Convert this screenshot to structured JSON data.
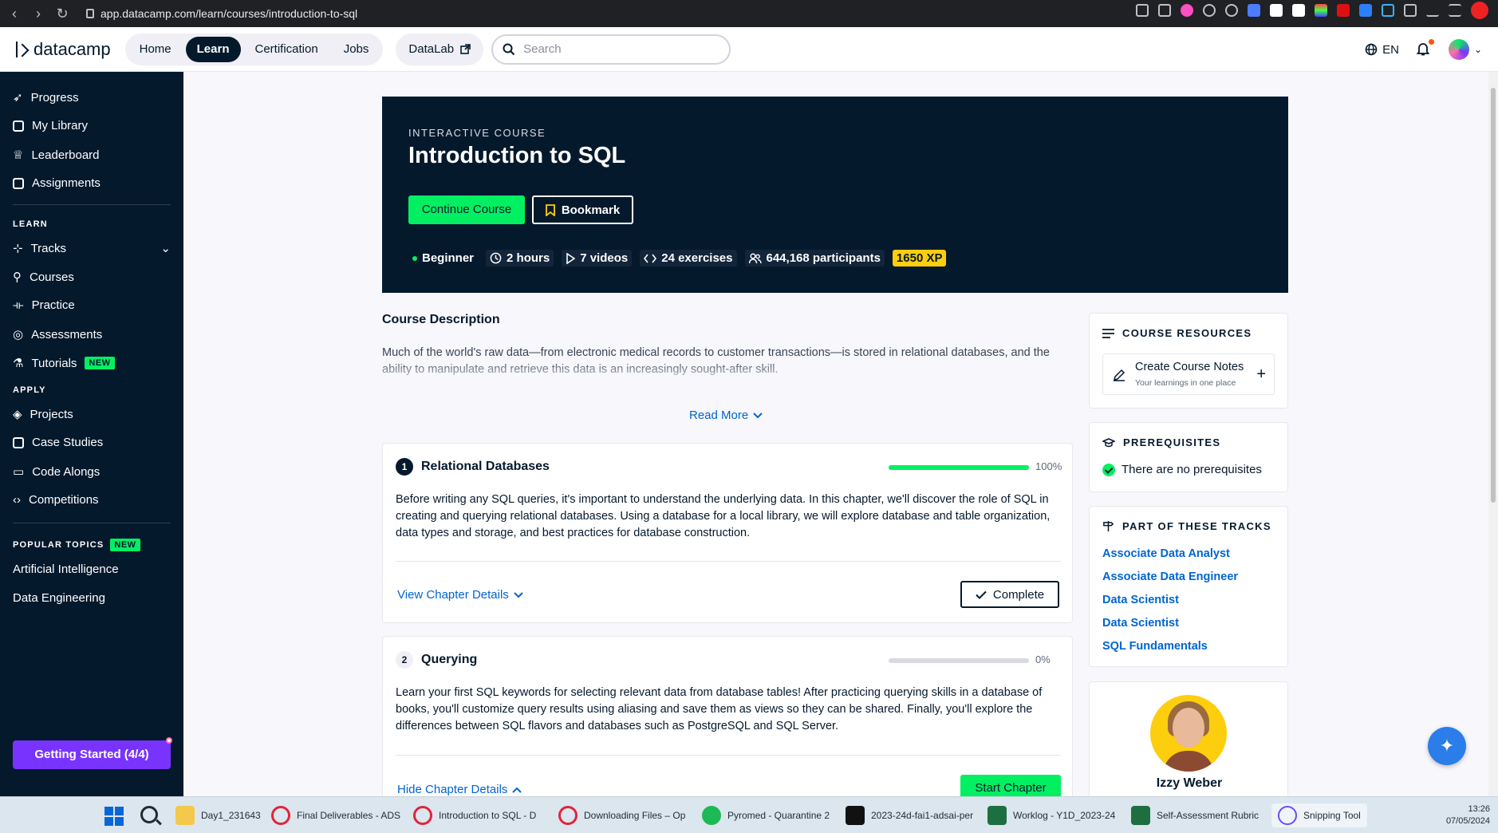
{
  "browser": {
    "url": "app.datacamp.com/learn/courses/introduction-to-sql"
  },
  "topnav": {
    "logo": "datacamp",
    "items": [
      "Home",
      "Learn",
      "Certification",
      "Jobs"
    ],
    "active": "Learn",
    "datalab": "DataLab",
    "search_placeholder": "Search",
    "lang": "EN"
  },
  "sidebar": {
    "main": [
      "Progress",
      "My Library",
      "Leaderboard",
      "Assignments"
    ],
    "learn_heading": "LEARN",
    "learn": [
      "Tracks",
      "Courses",
      "Practice",
      "Assessments",
      "Tutorials"
    ],
    "new_badge": "NEW",
    "apply_heading": "APPLY",
    "apply": [
      "Projects",
      "Case Studies",
      "Code Alongs",
      "Competitions"
    ],
    "popular_heading": "POPULAR TOPICS",
    "popular": [
      "Artificial Intelligence",
      "Data Engineering"
    ],
    "getting_started": "Getting Started (4/4)"
  },
  "hero": {
    "label": "INTERACTIVE COURSE",
    "title": "Introduction to SQL",
    "continue": "Continue Course",
    "bookmark": "Bookmark",
    "level": "Beginner",
    "duration": "2 hours",
    "videos": "7 videos",
    "exercises": "24 exercises",
    "participants": "644,168 participants",
    "xp": "1650 XP"
  },
  "description": {
    "title": "Course Description",
    "text": "Much of the world's raw data—from electronic medical records to customer transactions—is stored in relational databases, and the ability to manipulate and retrieve this data is an increasingly sought-after skill.",
    "read_more": "Read More"
  },
  "chapters": [
    {
      "num": "1",
      "title": "Relational Databases",
      "progress": 1.0,
      "pct": "100%",
      "text": "Before writing any SQL queries, it's important to understand the underlying data. In this chapter, we'll discover the role of SQL in creating and querying relational databases. Using a database for a local library, we will explore database and table organization, data types and storage, and best practices for database construction.",
      "link": "View Chapter Details",
      "button": "Complete"
    },
    {
      "num": "2",
      "title": "Querying",
      "progress": 0.0,
      "pct": "0%",
      "text": "Learn your first SQL keywords for selecting relevant data from database tables! After practicing querying skills in a database of books, you'll customize query results using aliasing and save them as views so they can be shared. Finally, you'll explore the differences between SQL flavors and databases such as PostgreSQL and SQL Server.",
      "link": "Hide Chapter Details",
      "button": "Start Chapter"
    }
  ],
  "resources": {
    "heading": "COURSE RESOURCES",
    "notes_title": "Create Course Notes",
    "notes_sub": "Your learnings in one place"
  },
  "prerequisites": {
    "heading": "PREREQUISITES",
    "text": "There are no prerequisites"
  },
  "tracks": {
    "heading": "PART OF THESE TRACKS",
    "items": [
      "Associate Data Analyst",
      "Associate Data Engineer",
      "Data Scientist",
      "Data Scientist",
      "SQL Fundamentals"
    ]
  },
  "instructor": {
    "name": "Izzy Weber"
  },
  "taskbar": {
    "apps": [
      "Day1_231643",
      "Final Deliverables - ADS",
      "Introduction to SQL - D",
      "Downloading Files – Op",
      "Pyromed - Quarantine 2",
      "2023-24d-fai1-adsai-per",
      "Worklog - Y1D_2023-24",
      "Self-Assessment Rubric",
      "Snipping Tool"
    ],
    "time": "13:26",
    "date": "07/05/2024"
  },
  "colors": {
    "navy": "#05192d",
    "green": "#03ef62",
    "purple": "#7933ff",
    "blue": "#0065d1",
    "yellow": "#fcce0d"
  }
}
